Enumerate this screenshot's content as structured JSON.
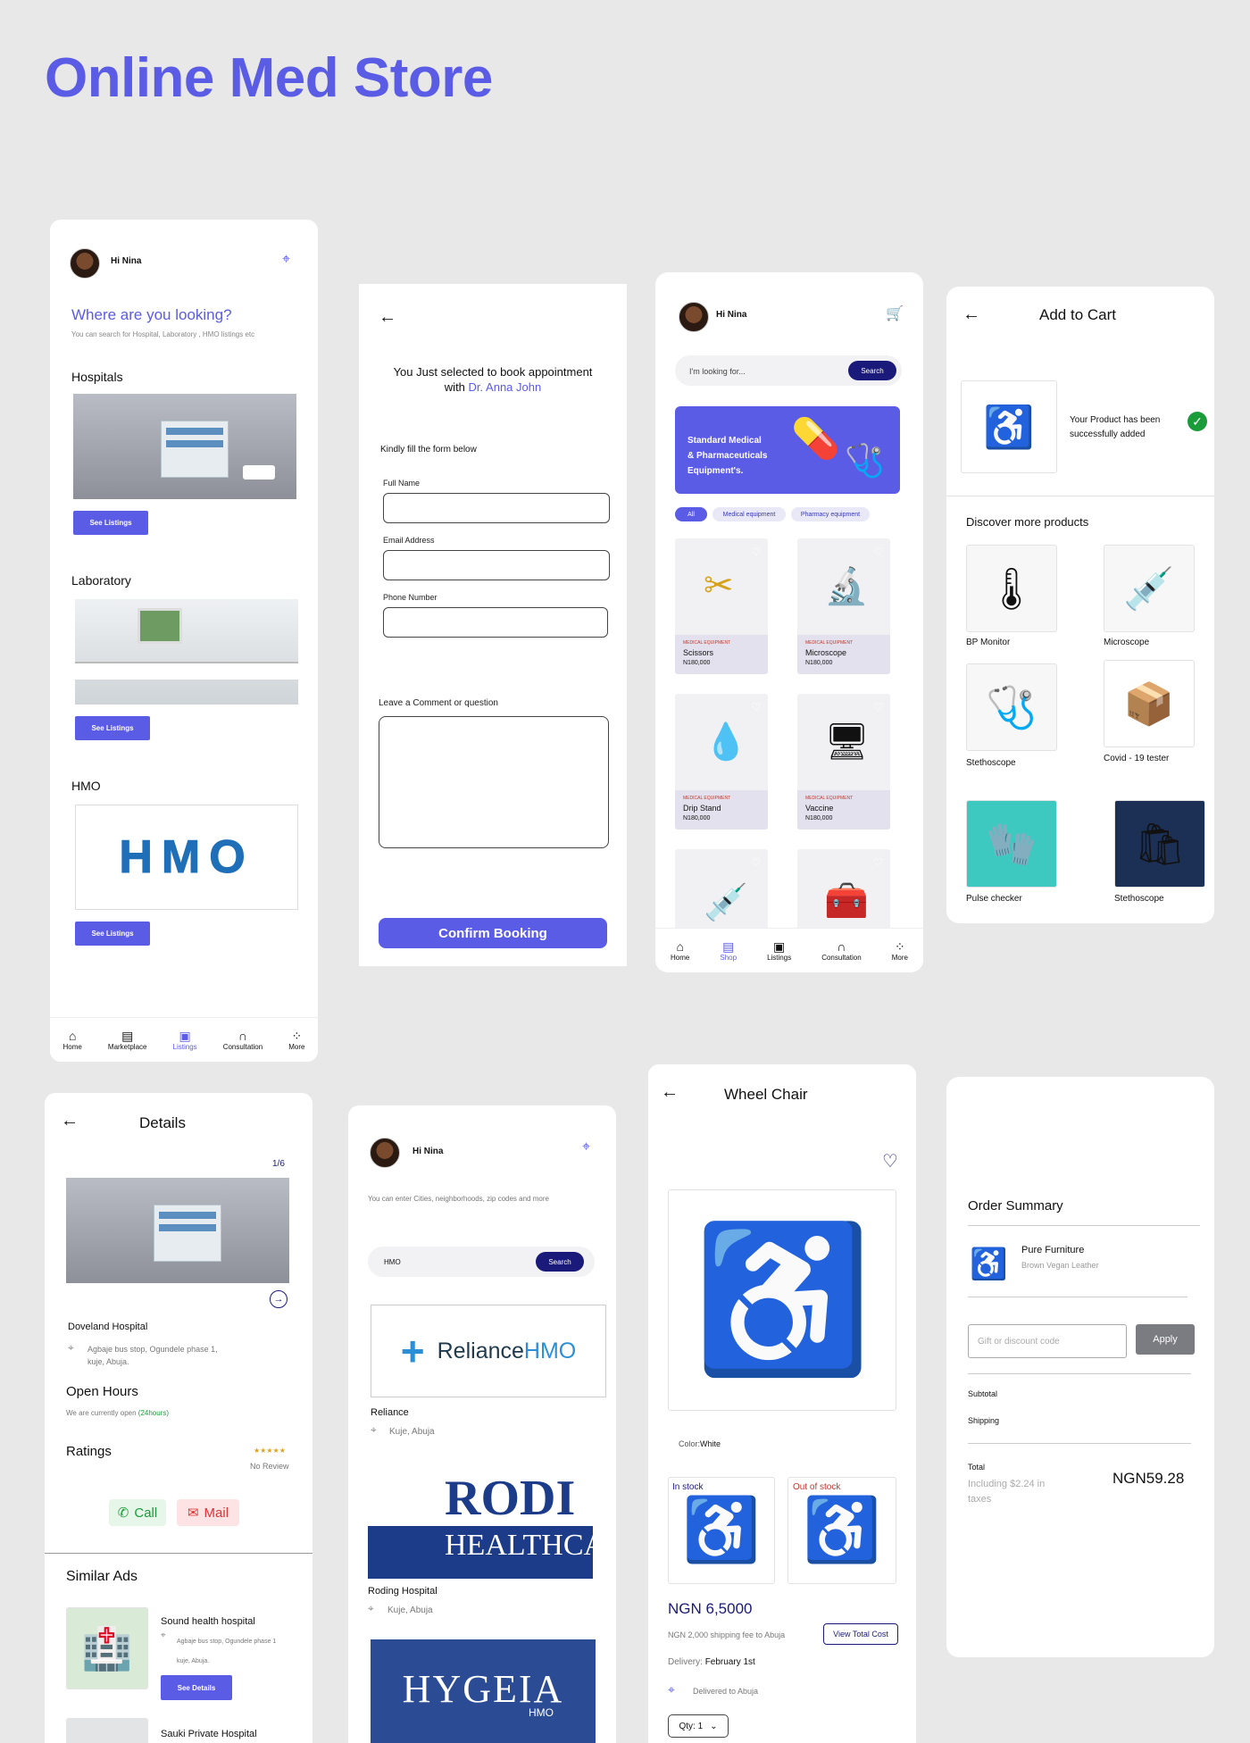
{
  "title": "Online Med Store",
  "listings": {
    "greeting": "Hi Nina",
    "heading": "Where are you looking?",
    "subheading": "You can search for Hospital, Laboratory , HMO listings etc",
    "sections": [
      {
        "label": "Hospitals",
        "button": "See Listings"
      },
      {
        "label": "Laboratory",
        "button": "See Listings"
      },
      {
        "label": "HMO",
        "button": "See Listings"
      }
    ],
    "hmo_logo": "HMO",
    "nav": [
      "Home",
      "Marketplace",
      "Listings",
      "Consultation",
      "More"
    ]
  },
  "booking": {
    "line1": "You Just selected to book appointment",
    "line2_prefix": "with ",
    "doctor": "Dr. Anna John",
    "instruction": "Kindly fill the form below",
    "fields": [
      "Full Name",
      "Email Address",
      "Phone Number"
    ],
    "comment_label": "Leave a Comment or question",
    "confirm": "Confirm Booking"
  },
  "shop": {
    "greeting": "Hi Nina",
    "search_placeholder": "I'm looking for...",
    "search_button": "Search",
    "banner": [
      "Standard Medical",
      "& Pharmaceuticals",
      "Equipment's."
    ],
    "chips": [
      "All",
      "Medical equipment",
      "Pharmacy equipment"
    ],
    "products": [
      {
        "category": "MEDICAL EQUIPMENT",
        "name": "Scissors",
        "price": "N180,000",
        "icon": "✂"
      },
      {
        "category": "MEDICAL EQUIPMENT",
        "name": "Microscope",
        "price": "N180,000",
        "icon": "🔬"
      },
      {
        "category": "MEDICAL EQUIPMENT",
        "name": "Drip Stand",
        "price": "N180,000",
        "icon": "💧"
      },
      {
        "category": "MEDICAL EQUIPMENT",
        "name": "Vaccine",
        "price": "N180,000",
        "icon": "🖥"
      },
      {
        "category": "",
        "name": "",
        "price": "",
        "icon": "💉"
      },
      {
        "category": "",
        "name": "",
        "price": "",
        "icon": "🧰"
      }
    ],
    "nav": [
      "Home",
      "Shop",
      "Listings",
      "Consultation",
      "More"
    ]
  },
  "cart": {
    "title": "Add to Cart",
    "added_line1": "Your Product has been",
    "added_line2": "successfully added",
    "discover": "Discover more products",
    "items": [
      {
        "name": "BP Monitor",
        "icon": "🌡"
      },
      {
        "name": "Microscope",
        "icon": "💉"
      },
      {
        "name": "Stethoscope",
        "icon": "🩺"
      },
      {
        "name": "Covid - 19 tester",
        "icon": "📦"
      },
      {
        "name": "Pulse checker",
        "icon": "🧤"
      },
      {
        "name": "Stethoscope",
        "icon": "🛍"
      }
    ]
  },
  "details": {
    "title": "Details",
    "counter": "1/6",
    "hospital_name": "Doveland Hospital",
    "address_line1": "Agbaje bus stop, Ogundele phase 1,",
    "address_line2": "kuje, Abuja.",
    "open_hours_title": "Open Hours",
    "open_status": "We are currently open",
    "open_hours": "(24hours)",
    "ratings_title": "Ratings",
    "stars": "★★★★★",
    "no_review": "No Review",
    "call": "Call",
    "mail": "Mail",
    "similar_title": "Similar Ads",
    "similar": [
      {
        "name": "Sound health hospital",
        "address1": "Agbaje bus stop, Ogundele phase 1",
        "address2": "kuje, Abuja.",
        "button": "See Details"
      },
      {
        "name": "Sauki Private Hospital"
      }
    ]
  },
  "hmo_search": {
    "greeting": "Hi Nina",
    "hint": "You can enter Cities, neighborhoods, zip codes and more",
    "query": "HMO",
    "search_button": "Search",
    "results": [
      {
        "logo_left": "Reliance",
        "logo_right": "HMO",
        "name": "Reliance",
        "location": "Kuje, Abuja"
      },
      {
        "logo_top": "RODI",
        "logo_bottom": "HEALTHCAR",
        "name": "Roding Hospital",
        "location": "Kuje, Abuja"
      },
      {
        "logo": "HYGEIA",
        "logo_sub": "HMO"
      }
    ]
  },
  "wheelchair": {
    "title": "Wheel Chair",
    "color_label": "Color:",
    "color_value": "White",
    "in_stock": "In stock",
    "out_of_stock": "Out  of stock",
    "price": "NGN 6,5000",
    "shipping": "NGN 2,000 shipping fee to Abuja",
    "view_total": "View Total Cost",
    "delivery_label": "Delivery:",
    "delivery_value": "February 1st",
    "delivered_to": "Delivered to Abuja",
    "qty": "Qty: 1"
  },
  "summary": {
    "title": "Order Summary",
    "item_name": "Pure Furniture",
    "item_desc": "Brown Vegan Leather",
    "discount_placeholder": "Gift or discount code",
    "apply": "Apply",
    "subtotal": "Subtotal",
    "shipping": "Shipping",
    "total": "Total",
    "tax_line1": "Including $2.24 in",
    "tax_line2": "taxes",
    "total_value": "NGN59.28"
  },
  "colors": {
    "accent": "#5b5ce6",
    "navy": "#1a1a7a",
    "success": "#1a9c3a"
  }
}
